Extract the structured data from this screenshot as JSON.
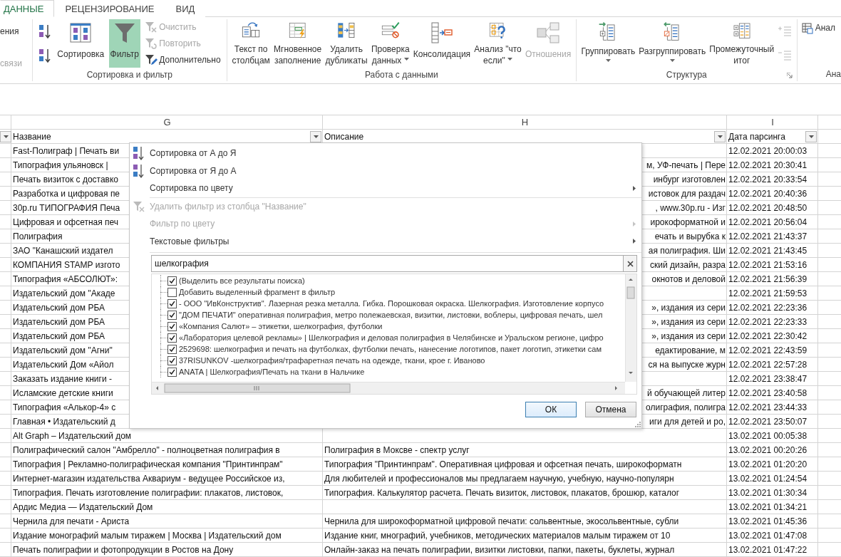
{
  "tabs": [
    {
      "label": "ДАННЫЕ",
      "selected": true
    },
    {
      "label": "РЕЦЕНЗИРОВАНИЕ",
      "selected": false
    },
    {
      "label": "ВИД",
      "selected": false
    }
  ],
  "ribbon": {
    "partial_left": [
      {
        "label": "ения",
        "disabled": false
      },
      {
        "label": "связи",
        "disabled": true
      }
    ],
    "groups": [
      {
        "label": "Сортировка и фильтр",
        "items": [
          {
            "kind": "icon"
          },
          {
            "kind": "icon"
          },
          {
            "kind": "large",
            "lines": [
              "Сортировка"
            ],
            "dropdown": false,
            "disabled": false,
            "selected": false
          },
          {
            "kind": "large",
            "lines": [
              "Фильтр"
            ],
            "dropdown": false,
            "disabled": false,
            "selected": true
          },
          {
            "kind": "small",
            "label": "Очистить",
            "disabled": true
          },
          {
            "kind": "small",
            "label": "Повторить",
            "disabled": true
          },
          {
            "kind": "small",
            "label": "Дополнительно",
            "disabled": false
          }
        ]
      },
      {
        "label": "Работа с данными",
        "items": [
          {
            "kind": "large",
            "lines": [
              "Текст по",
              "столбцам"
            ],
            "dropdown": false,
            "disabled": false,
            "selected": false
          },
          {
            "kind": "large",
            "lines": [
              "Мгновенное",
              "заполнение"
            ],
            "dropdown": false,
            "disabled": false,
            "selected": false
          },
          {
            "kind": "large",
            "lines": [
              "Удалить",
              "дубликаты"
            ],
            "dropdown": false,
            "disabled": false,
            "selected": false
          },
          {
            "kind": "large",
            "lines": [
              "Проверка",
              "данных"
            ],
            "dropdown": true,
            "disabled": false,
            "selected": false
          },
          {
            "kind": "large",
            "lines": [
              "Консолидация"
            ],
            "dropdown": false,
            "disabled": false,
            "selected": false
          },
          {
            "kind": "large",
            "lines": [
              "Анализ \"что",
              "если\""
            ],
            "dropdown": true,
            "disabled": false,
            "selected": false
          },
          {
            "kind": "large",
            "lines": [
              "Отношения"
            ],
            "dropdown": false,
            "disabled": true,
            "selected": false
          }
        ]
      },
      {
        "label": "Структура",
        "launcher": true,
        "items": [
          {
            "kind": "large",
            "lines": [
              "Группировать"
            ],
            "dropdown": true,
            "disabled": false,
            "selected": false
          },
          {
            "kind": "large",
            "lines": [
              "Разгруппировать"
            ],
            "dropdown": true,
            "disabled": false,
            "selected": false
          },
          {
            "kind": "large",
            "lines": [
              "Промежуточный",
              "итог"
            ],
            "dropdown": false,
            "disabled": false,
            "selected": false
          },
          {
            "kind": "icon",
            "disabled": true
          },
          {
            "kind": "icon",
            "disabled": true
          }
        ]
      }
    ],
    "partial_right": {
      "label": "Анал",
      "group_label": "Ана"
    }
  },
  "sheet": {
    "columns": [
      {
        "letter": "G",
        "title": "Название"
      },
      {
        "letter": "H",
        "title": "Описание"
      },
      {
        "letter": "I",
        "title": "Дата парсинга"
      }
    ],
    "rows": [
      {
        "name": "Fast-Полиграф | Печать ви",
        "date": "12.02.2021 20:00:03"
      },
      {
        "name": "Типография ульяновск |",
        "description": "м, УФ-печать | Пере",
        "date": "12.02.2021 20:30:41"
      },
      {
        "name": "Печать визиток с доставко",
        "description": "инбург изготовлен",
        "date": "12.02.2021 20:33:54"
      },
      {
        "name": "Разработка и цифровая пе",
        "description": "истовок для раздач",
        "date": "12.02.2021 20:40:36"
      },
      {
        "name": "30p.ru ТИПОГРАФИЯ Печа",
        "description": ", www.30p.ru - Изг",
        "date": "12.02.2021 20:48:50"
      },
      {
        "name": "Цифровая и офсетная печ",
        "description": "ирокоформатной и",
        "date": "12.02.2021 20:56:04"
      },
      {
        "name": "Полиграфия",
        "description": "ечать и вырубка к",
        "date": "12.02.2021 21:43:37"
      },
      {
        "name": "ЗАО \"Канашский издател",
        "description": "ая полиграфия. Ши",
        "date": "12.02.2021 21:43:45"
      },
      {
        "name": "КОМПАНИЯ STAMP изгото",
        "description": "ский дизайн, разра",
        "date": "12.02.2021 21:53:16"
      },
      {
        "name": "Типография «АБСОЛЮТ»:",
        "description": "окнотов и деловой",
        "date": "12.02.2021 21:56:39"
      },
      {
        "name": "Издательский дом \"Акаде",
        "date": "12.02.2021 21:59:53"
      },
      {
        "name": "Издательский дом РБА",
        "description": "», издания из сери",
        "date": "12.02.2021 22:23:36"
      },
      {
        "name": "Издательский дом РБА",
        "description": "», издания из сери",
        "date": "12.02.2021 22:23:33"
      },
      {
        "name": "Издательский дом РБА",
        "description": "», издания из сери",
        "date": "12.02.2021 22:30:42"
      },
      {
        "name": "Издательский дом \"Агни\"",
        "description": "едактирование, м",
        "date": "12.02.2021 22:43:59"
      },
      {
        "name": "Издательский Дом «Айол",
        "description": "ся на выпуске журн",
        "date": "12.02.2021 22:57:28"
      },
      {
        "name": "Заказать издание книги -",
        "date": "12.02.2021 23:38:47"
      },
      {
        "name": "Исламские детские книги",
        "description": "й обучающей литер",
        "date": "12.02.2021 23:40:58"
      },
      {
        "name": "Типография «Алькор-4» с",
        "description": "олиграфия, полигра",
        "date": "12.02.2021 23:44:33"
      },
      {
        "name": "Главная • Издательский д",
        "description": "иги для детей и ро,",
        "date": "12.02.2021 23:50:07"
      },
      {
        "name": "Alt Graph – Издательский дом",
        "date": "13.02.2021 00:05:38"
      },
      {
        "name": "Полиграфический салон \"Амбрелло\" - полноцветная полиграфия в",
        "description": "Полиграфия в Моксве - спектр услуг",
        "date": "13.02.2021 00:20:26"
      },
      {
        "name": "Типография | Рекламно-полиграфическая компания \"Принтинпрам\"",
        "description": "Типография \"Принтинпрам\". Оперативная цифровая и офсетная печать, широкоформатн",
        "date": "13.02.2021 01:20:20"
      },
      {
        "name": "Интернет-магазин издательства Аквариум - ведущее Российское из,",
        "description": "Для любителей и профессионалов мы предлагаем научную, учебную, научно-популярн",
        "date": "13.02.2021 01:24:54"
      },
      {
        "name": "Типография. Печать изготовление полиграфии: плакатов, листовок,",
        "description": "Типография. Калькулятор расчета. Печать визиток, листовок, плакатов, брошюр, каталог",
        "date": "13.02.2021 01:30:34"
      },
      {
        "name": "Ардис Медиа — Издательский Дом",
        "date": "13.02.2021 01:34:21"
      },
      {
        "name": "Чернила для печати - Ариста",
        "description": "Чернила для широкоформатной цифровой печати: сольвентные, экосольвентные, субли",
        "date": "13.02.2021 01:45:36"
      },
      {
        "name": "Издание монографий малым тиражем | Москва | Издательский дом",
        "description": "Издание книг, мнографий, учебников, методических материалов малым тиражем от 10",
        "date": "13.02.2021 01:47:08"
      },
      {
        "name": "Печать полиграфии и фотопродукции в Ростов на Дону",
        "description": "Онлайн-заказ на печать полиграфии, визитки листовки, папки, пакеты, буклеты, журнал",
        "date": "13.02.2021 01:47:22"
      }
    ]
  },
  "filter_popup": {
    "menu": [
      [
        {
          "label": "Сортировка от А до Я",
          "kind": "sort-asc",
          "disabled": false,
          "submenu": false
        },
        {
          "label": "Сортировка от Я до А",
          "kind": "sort-desc",
          "disabled": false,
          "submenu": false
        },
        {
          "label": "Сортировка по цвету",
          "kind": "plain",
          "disabled": false,
          "submenu": true
        }
      ],
      [
        {
          "label": "Удалить фильтр из столбца \"Название\"",
          "kind": "clear-filter",
          "disabled": true,
          "submenu": false
        },
        {
          "label": "Фильтр по цвету",
          "kind": "plain",
          "disabled": true,
          "submenu": true
        },
        {
          "label": "Текстовые фильтры",
          "kind": "plain",
          "disabled": false,
          "submenu": true
        }
      ]
    ],
    "search": {
      "value": "шелкография"
    },
    "list": [
      {
        "label": "(Выделить все результаты поиска)",
        "checked": true
      },
      {
        "label": "Добавить выделенный фрагмент в фильтр",
        "checked": false
      },
      {
        "label": "- ООО \"ИвКонструктив\". Лазерная резка металла. Гибка. Порошковая окраска. Шелкография. Изготовление корпусо",
        "checked": true
      },
      {
        "label": "\"ДОМ ПЕЧАТИ\" оперативная полиграфия, метро полежаевская, визитки, листовки, воблеры, цифровая печать, шел",
        "checked": true
      },
      {
        "label": "«Компания Салют» – этикетки, шелкография, футболки",
        "checked": true
      },
      {
        "label": "«Лаборатория целевой рекламы» | Шелкография и деловая полиграфия в Челябинске и Уральском регионе, цифро",
        "checked": true
      },
      {
        "label": "2529698: шелкография и печать на футболках, футболки печать, нанесение логотипов, пакет логотип, этикетки сам",
        "checked": true
      },
      {
        "label": "37RISUNKOV -шелкография/трафаретная печать на одежде, ткани, крое г. Иваново",
        "checked": true
      },
      {
        "label": "ANATA | Шелкография/Печать на ткани в Нальчике",
        "checked": true
      }
    ],
    "buttons": [
      {
        "label": "ОК",
        "default": true
      },
      {
        "label": "Отмена",
        "default": false
      }
    ]
  }
}
